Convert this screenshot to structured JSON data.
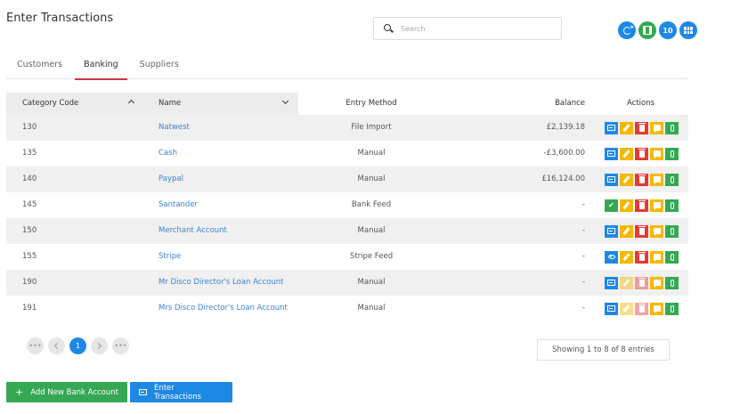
{
  "page": {
    "title": "Enter Transactions"
  },
  "search": {
    "placeholder": "Search"
  },
  "top_buttons": {
    "count": "10"
  },
  "tabs": [
    {
      "label": "Customers",
      "active": false
    },
    {
      "label": "Banking",
      "active": true
    },
    {
      "label": "Suppliers",
      "active": false
    }
  ],
  "table": {
    "headers": {
      "code": "Category Code",
      "name": "Name",
      "method": "Entry Method",
      "balance": "Balance",
      "actions": "Actions"
    },
    "rows": [
      {
        "code": "130",
        "name": "Natwest",
        "method": "File Import",
        "balance": "£2,139.18",
        "first_action": "transfer",
        "faded": false
      },
      {
        "code": "135",
        "name": "Cash",
        "method": "Manual",
        "balance": "-£3,600.00",
        "first_action": "transfer",
        "faded": false
      },
      {
        "code": "140",
        "name": "Paypal",
        "method": "Manual",
        "balance": "£16,124.00",
        "first_action": "transfer",
        "faded": false
      },
      {
        "code": "145",
        "name": "Santander",
        "method": "Bank Feed",
        "balance": "-",
        "first_action": "check",
        "faded": false
      },
      {
        "code": "150",
        "name": "Merchant Account",
        "method": "Manual",
        "balance": "-",
        "first_action": "transfer",
        "faded": false
      },
      {
        "code": "155",
        "name": "Stripe",
        "method": "Stripe Feed",
        "balance": "-",
        "first_action": "view",
        "faded": false
      },
      {
        "code": "190",
        "name": "Mr Disco Director's Loan Account",
        "method": "Manual",
        "balance": "-",
        "first_action": "transfer",
        "faded": true
      },
      {
        "code": "191",
        "name": "Mrs Disco Director's Loan Account",
        "method": "Manual",
        "balance": "-",
        "first_action": "transfer",
        "faded": true
      }
    ]
  },
  "pagination": {
    "ellipsis": "•••",
    "current": "1"
  },
  "info": {
    "text": "Showing 1 to 8 of 8 entries"
  },
  "buttons": {
    "add_bank": "Add New Bank Account",
    "enter_transactions": "Enter Transactions"
  },
  "colors": {
    "primary": "#1e88e5",
    "success": "#34a853",
    "danger": "#e53935",
    "warning": "#f5b800",
    "tab_accent": "#d0324b",
    "link": "#3b82d6"
  }
}
